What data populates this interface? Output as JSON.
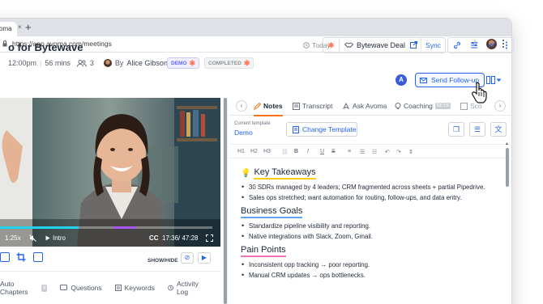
{
  "browser": {
    "tab_title": "oma",
    "tab_close": "×",
    "new_tab": "+",
    "url": "https://app.avoma.com/meetings",
    "star": "☆",
    "menu": "⋮"
  },
  "meeting": {
    "title": "o for Bytewave",
    "time": "12:00pm",
    "duration": "56 mins",
    "attendee_count": "3",
    "by_prefix": "By",
    "organizer": "Alice Gibson",
    "badge_demo": "DEMO",
    "badge_completed": "COMPLETED"
  },
  "header": {
    "today": "Today",
    "deal_name": "Bytewave Deal",
    "sync": "Sync",
    "avatar_initial": "A",
    "send_followup": "Send Follow-up"
  },
  "video": {
    "speed": "1.25x",
    "chapter": "Intro",
    "cc": "CC",
    "time": "17:36/ 47:28",
    "progress": 0.37
  },
  "left_toolbar": {
    "show_hide": "SHOW/HIDE"
  },
  "left_tabs": [
    {
      "label": "Auto Chapters",
      "count": "9"
    },
    {
      "label": "Questions"
    },
    {
      "label": "Keywords"
    },
    {
      "label": "Activity Log"
    }
  ],
  "right_tabs": {
    "notes": "Notes",
    "transcript": "Transcript",
    "ask_avoma": "Ask Avoma",
    "coaching": "Coaching",
    "beta": "BETA",
    "scorecards": "Sco"
  },
  "template": {
    "label": "Current template",
    "value": "Demo",
    "change_button": "Change Template"
  },
  "format_bar": [
    "H1",
    "H2",
    "H3",
    "B",
    "I",
    "U",
    "S"
  ],
  "notes": {
    "key_takeaways": {
      "emoji": "💡",
      "heading": "Key Takeaways",
      "items": [
        "30 SDRs managed by 4 leaders; CRM fragmented across sheets + partial Pipedrive.",
        "Sales ops stretched; want automation for routing, follow-ups, and data entry."
      ]
    },
    "business_goals": {
      "heading": "Business Goals",
      "items": [
        "Standardize pipeline visibility and reporting.",
        "Native integrations with Slack, Zoom, Gmail."
      ]
    },
    "pain_points": {
      "heading": "Pain Points",
      "items": [
        "Inconsistent opp tracking → poor reporting.",
        "Manual CRM updates → ops bottlenecks."
      ]
    }
  },
  "colors": {
    "accent": "#2563eb",
    "hubspot": "#ff7a59",
    "active_tab_underline": "#f97316"
  }
}
